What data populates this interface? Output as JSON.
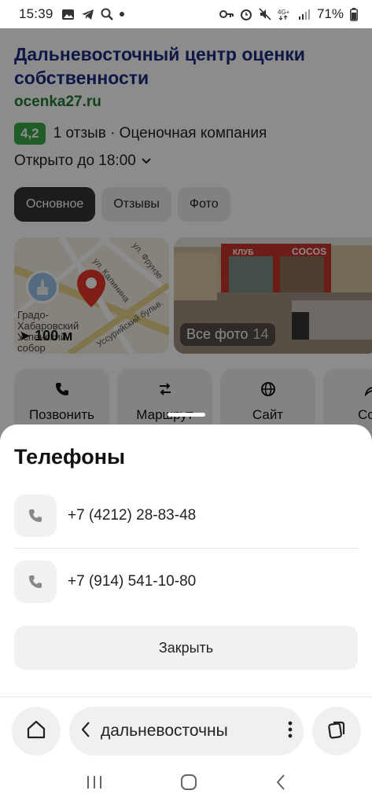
{
  "status_bar": {
    "time": "15:39",
    "battery": "71%",
    "network": "4G+"
  },
  "place": {
    "name": "Дальневосточный центр оценки собственности",
    "website": "ocenka27.ru",
    "rating": "4,2",
    "reviews_category": "1 отзыв · Оценочная компания",
    "hours": "Открыто до 18:00"
  },
  "tabs": [
    {
      "label": "Основное",
      "active": true
    },
    {
      "label": "Отзывы",
      "active": false
    },
    {
      "label": "Фото",
      "active": false
    }
  ],
  "map_thumb": {
    "distance": "100 м",
    "poi_label": "Градо-Хабаровский Успенский собор",
    "streets": [
      "ул. Калинина",
      "ул. Фрунзе",
      "Уссурийский бульв."
    ]
  },
  "photo_thumb": {
    "label": "Все фото",
    "count": "14",
    "sign_texts": [
      "КЛУБ",
      "COCOS"
    ]
  },
  "actions": [
    {
      "label": "Позвонить",
      "icon": "phone-icon"
    },
    {
      "label": "Маршрут",
      "icon": "route-icon"
    },
    {
      "label": "Сайт",
      "icon": "globe-icon"
    },
    {
      "label": "Ссы",
      "icon": "share-icon"
    }
  ],
  "sheet": {
    "title": "Телефоны",
    "phones": [
      "+7 (4212) 28-83-48",
      "+7 (914) 541-10-80"
    ],
    "close_label": "Закрыть"
  },
  "browser": {
    "url_text": "дальневосточны"
  },
  "colors": {
    "title_blue": "#1b2a80",
    "site_green": "#1e7a34",
    "rating_green": "#3aa84a"
  }
}
